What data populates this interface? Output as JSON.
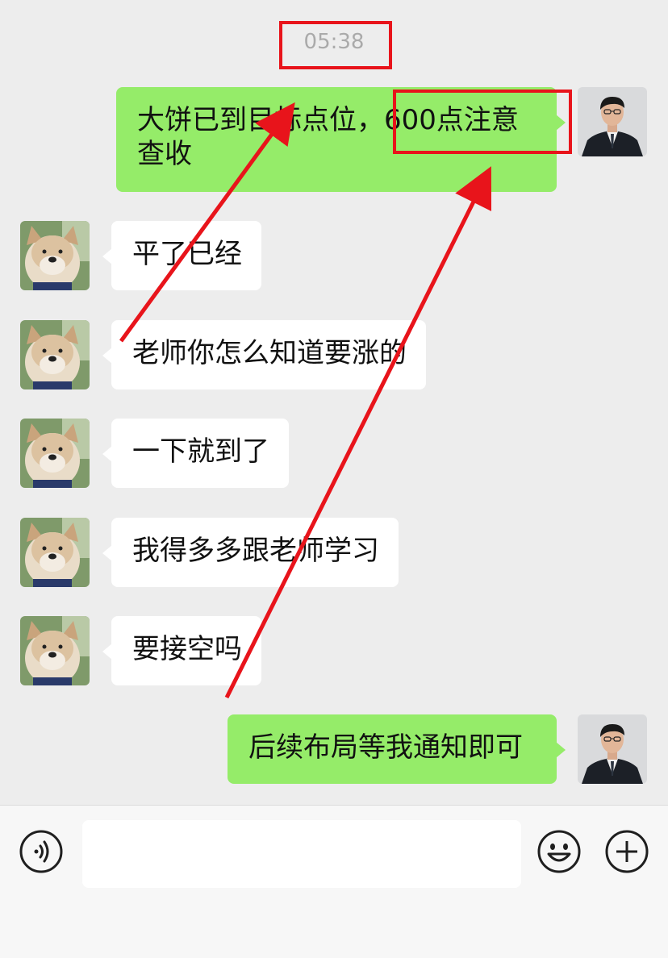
{
  "chat": {
    "timestamp": "05:38",
    "messages": [
      {
        "sender": "teacher",
        "direction": "out",
        "text": "大饼已到目标点位，600点注意查收"
      },
      {
        "sender": "student",
        "direction": "in",
        "text": "平了已经"
      },
      {
        "sender": "student",
        "direction": "in",
        "text": "老师你怎么知道要涨的"
      },
      {
        "sender": "student",
        "direction": "in",
        "text": "一下就到了"
      },
      {
        "sender": "student",
        "direction": "in",
        "text": "我得多多跟老师学习"
      },
      {
        "sender": "student",
        "direction": "in",
        "text": "要接空吗"
      },
      {
        "sender": "teacher",
        "direction": "out",
        "text": "后续布局等我通知即可"
      }
    ]
  },
  "input_bar": {
    "input_value": "",
    "icons": [
      "voice-icon",
      "emoji-icon",
      "plus-icon"
    ]
  },
  "colors": {
    "background": "#ededed",
    "outgoing_bubble": "#95ec69",
    "incoming_bubble": "#ffffff",
    "annotation_red": "#e8141b"
  }
}
